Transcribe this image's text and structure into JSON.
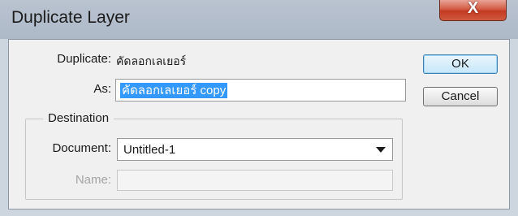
{
  "window": {
    "title": "Duplicate Layer",
    "close_glyph": "X"
  },
  "form": {
    "duplicate_label": "Duplicate:",
    "duplicate_value": "คัดลอกเลเยอร์",
    "as_label": "As:",
    "as_value": "คัดลอกเลเยอร์ copy",
    "destination_label": "Destination",
    "document_label": "Document:",
    "document_value": "Untitled-1",
    "name_label": "Name:",
    "name_value": ""
  },
  "buttons": {
    "ok_label": "OK",
    "cancel_label": "Cancel"
  }
}
